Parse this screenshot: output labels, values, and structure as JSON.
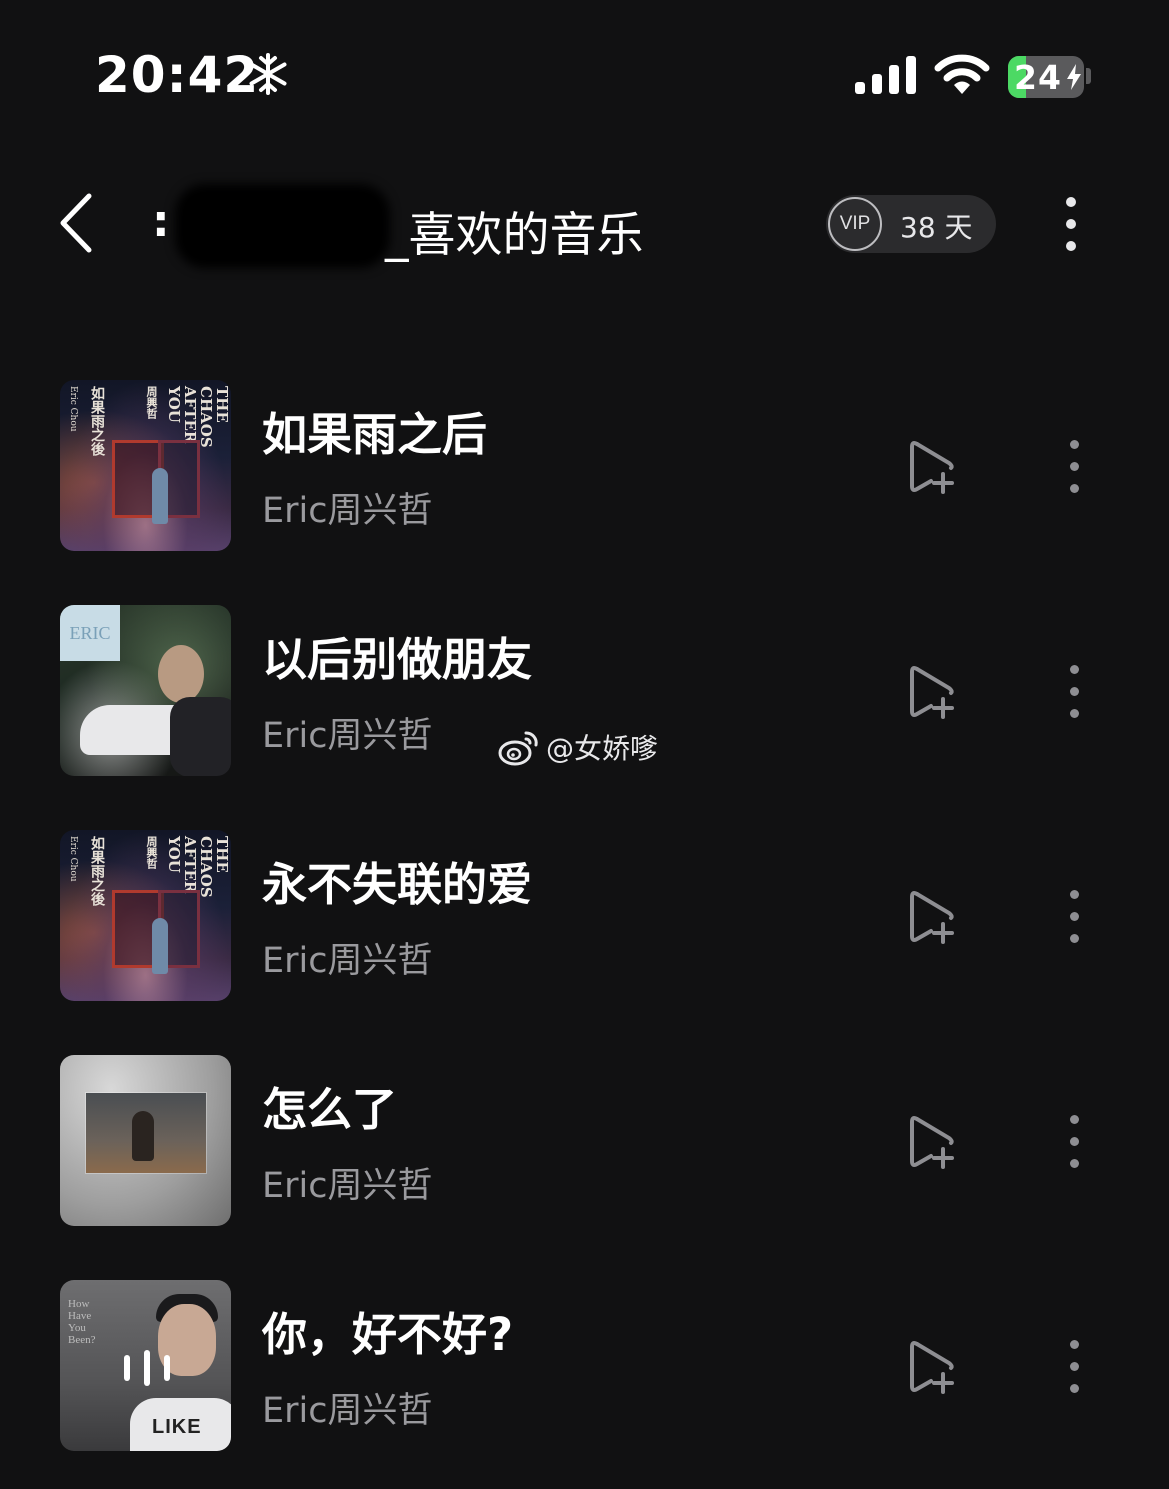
{
  "status_bar": {
    "time": "20:42",
    "mode_icon": "snowflake-icon",
    "signal_icon": "cellular-signal-icon",
    "wifi_icon": "wifi-icon",
    "battery": "24",
    "battery_level": 0.24,
    "battery_color": "#4cd964",
    "battery_icon": "charging-bolt-icon"
  },
  "header": {
    "back_icon": "chevron-left-icon",
    "title_prefix": ":",
    "title": "_喜欢的音乐",
    "vip_badge": "VIP",
    "vip_days": "38 天",
    "more_icon": "more-vertical-icon"
  },
  "songs": [
    {
      "title": "如果雨之后",
      "artist": "Eric周兴哲"
    },
    {
      "title": "以后别做朋友",
      "artist": "Eric周兴哲"
    },
    {
      "title": "永不失联的爱",
      "artist": "Eric周兴哲"
    },
    {
      "title": "怎么了",
      "artist": "Eric周兴哲"
    },
    {
      "title": "你，好不好?",
      "artist": "Eric周兴哲",
      "playing": true
    }
  ],
  "cover_text": {
    "chaos": [
      "THE",
      "CHAOS",
      "AFTER",
      "YOU"
    ],
    "chaos_cn": "如果雨之後",
    "chaos_name": "周興哲",
    "chaos_eric": "Eric Chou",
    "forest_tag": "ERIC",
    "hhyb_small": "How Have You Been?",
    "hhyb_shirt": "LIKE"
  },
  "watermark": {
    "icon": "weibo-icon",
    "text": "@女娇嗲"
  },
  "colors": {
    "background": "#111112",
    "primary_text": "#ffffff",
    "secondary_text": "#9a9a9e",
    "icon_grey": "#8e8e92"
  }
}
